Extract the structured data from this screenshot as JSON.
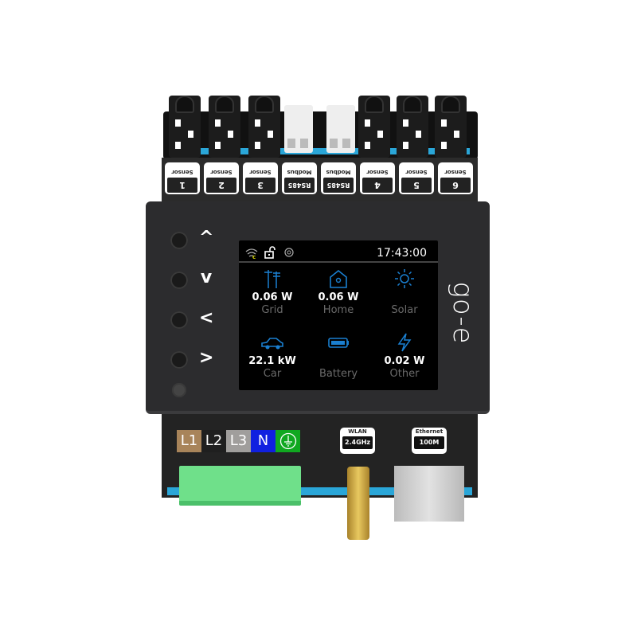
{
  "ports": [
    {
      "number": "1",
      "label": "Sensor"
    },
    {
      "number": "2",
      "label": "Sensor"
    },
    {
      "number": "3",
      "label": "Sensor"
    },
    {
      "number": "RS485",
      "label": "Modbus"
    },
    {
      "number": "RS485",
      "label": "Modbus"
    },
    {
      "number": "4",
      "label": "Sensor"
    },
    {
      "number": "5",
      "label": "Sensor"
    },
    {
      "number": "6",
      "label": "Sensor"
    }
  ],
  "nav_buttons": {
    "up": "^",
    "down": "v",
    "left": "<",
    "right": ">"
  },
  "screen": {
    "status_icons": [
      "wifi-icon",
      "unlock-icon",
      "network-icon"
    ],
    "time": "17:43:00",
    "tiles": [
      {
        "icon": "grid-pylon-icon",
        "value": "0.06 W",
        "name": "Grid"
      },
      {
        "icon": "home-icon",
        "value": "0.06 W",
        "name": "Home"
      },
      {
        "icon": "sun-icon",
        "value": "",
        "name": "Solar"
      },
      {
        "icon": "car-icon",
        "value": "22.1 kW",
        "name": "Car"
      },
      {
        "icon": "battery-icon",
        "value": "",
        "name": "Battery"
      },
      {
        "icon": "lightning-icon",
        "value": "0.02 W",
        "name": "Other"
      }
    ],
    "accent": "#1a7fd0"
  },
  "brand": "go-e",
  "phases": [
    {
      "label": "L1",
      "color": "#a8845a"
    },
    {
      "label": "L2",
      "color": "#1f1f1f"
    },
    {
      "label": "L3",
      "color": "#a09e9c"
    },
    {
      "label": "N",
      "color": "#1020e0"
    },
    {
      "label": "",
      "color": "#10a820",
      "icon": "ground-icon"
    }
  ],
  "wlan": {
    "title": "WLAN",
    "value": "2.4GHz"
  },
  "ethernet": {
    "title": "Ethernet",
    "value": "100M"
  }
}
